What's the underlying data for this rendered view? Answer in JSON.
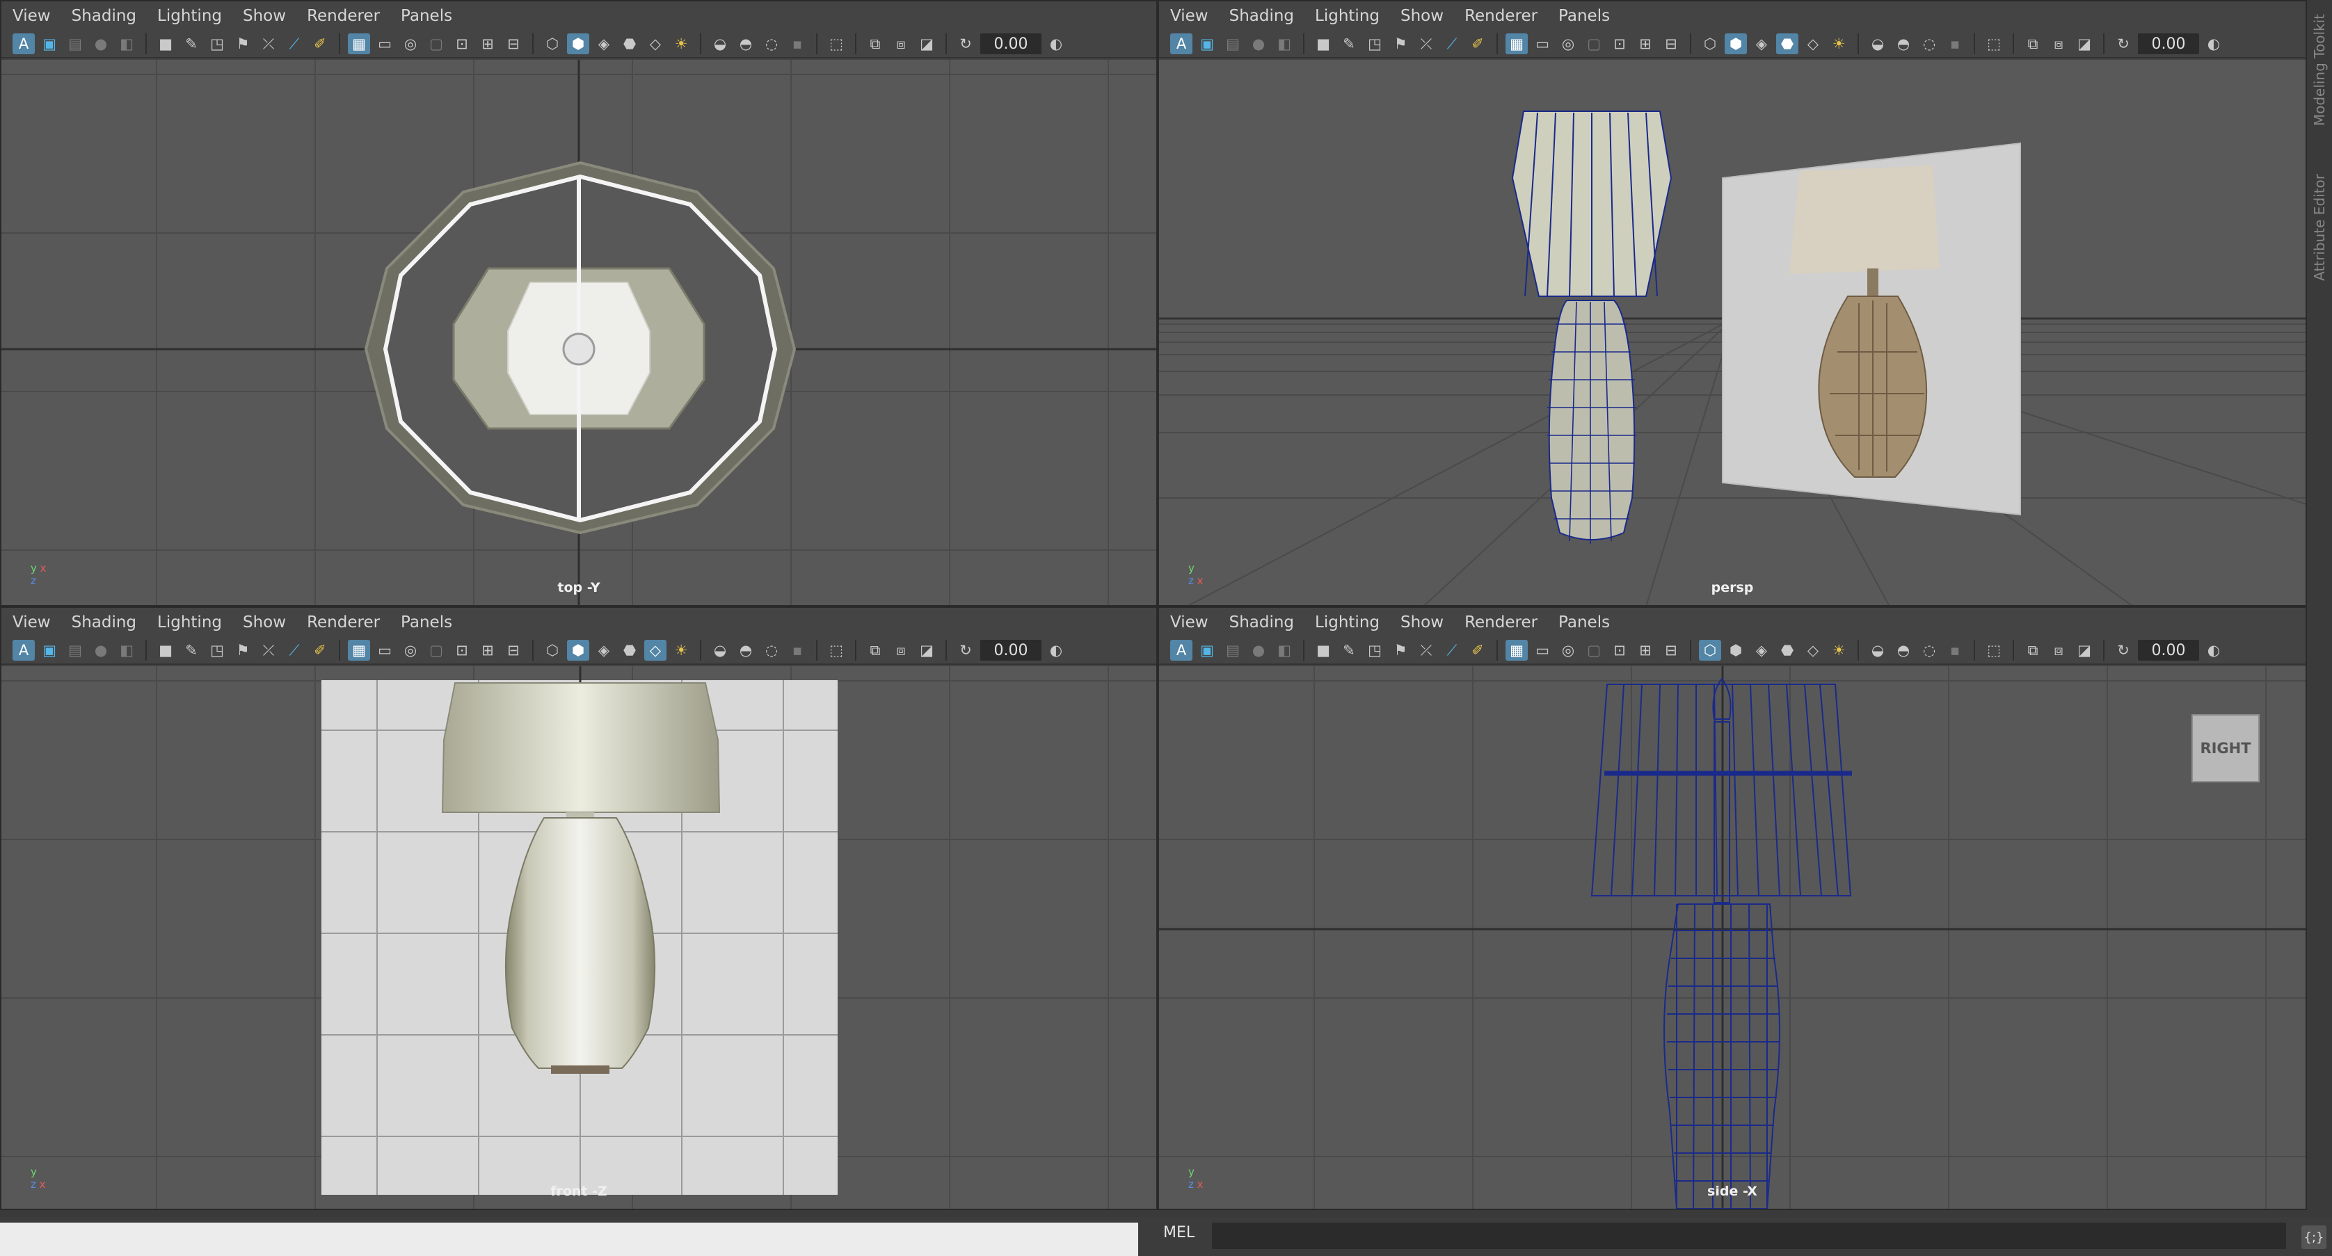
{
  "menus": [
    "View",
    "Shading",
    "Lighting",
    "Show",
    "Renderer",
    "Panels"
  ],
  "toolbar": {
    "time_value": "0.00",
    "icons": [
      "select-icon",
      "camera-icon",
      "bookmark-icon",
      "grid-icon",
      "wireframe-icon",
      "smooth-shade-icon",
      "texture-icon",
      "light-icon",
      "shadow-icon",
      "isolate-icon",
      "xray-icon",
      "resolution-gate-icon",
      "refresh-icon"
    ]
  },
  "viewports": {
    "top": {
      "label": "top -Y",
      "axis_a": "y",
      "axis_b": "z",
      "axis_c": "x"
    },
    "persp": {
      "label": "persp",
      "axis_a": "y",
      "axis_b": "z",
      "axis_c": "x"
    },
    "front": {
      "label": "front -Z",
      "axis_a": "y",
      "axis_b": "z",
      "axis_c": "x"
    },
    "side": {
      "label": "side -X",
      "axis_a": "y",
      "axis_b": "z",
      "axis_c": "x",
      "viewcube": "RIGHT"
    }
  },
  "side_tabs": [
    "Modeling Toolkit",
    "Attribute Editor"
  ],
  "command_line": {
    "mel_label": "MEL",
    "mel_button": "{;}"
  },
  "colors": {
    "selection_blue": "#5285a6",
    "wire_blue": "#1a2a8a",
    "lamp_shade": "#cfcfbd"
  }
}
